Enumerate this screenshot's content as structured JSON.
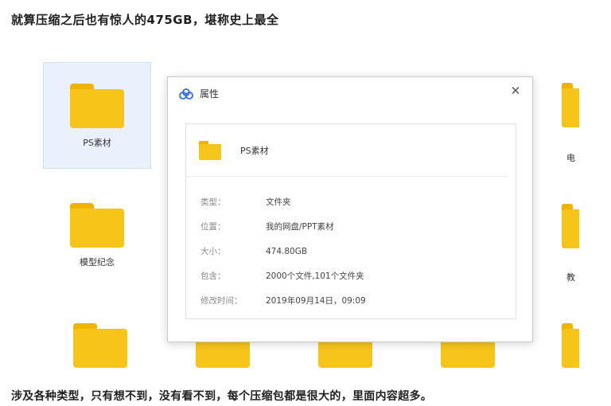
{
  "headline": "就算压缩之后也有惊人的475GB，堪称史上最全",
  "footline": "涉及各种类型，只有想不到，没有看不到，每个压缩包都是很大的，里面内容超多。",
  "folders": {
    "selected_label": "PS素材",
    "row2_label": "模型纪念",
    "edge_label_1": "电",
    "edge_label_2": "教"
  },
  "dialog": {
    "title": "属性",
    "close_icon": "close-icon",
    "folder_name": "PS素材",
    "properties": [
      {
        "key": "类型：",
        "value": "文件夹"
      },
      {
        "key": "位置：",
        "value": "我的网盘/PPT素材"
      },
      {
        "key": "大小：",
        "value": "474.80GB"
      },
      {
        "key": "包含：",
        "value": "2000个文件,101个文件夹"
      },
      {
        "key": "修改时间：",
        "value": "2019年09月14日，09:09"
      }
    ]
  },
  "colors": {
    "folder": "#f7c51a",
    "folder_tab": "#f0b400",
    "selection": "#e8f1fc",
    "cloud_icon": "#2f6ce5"
  }
}
